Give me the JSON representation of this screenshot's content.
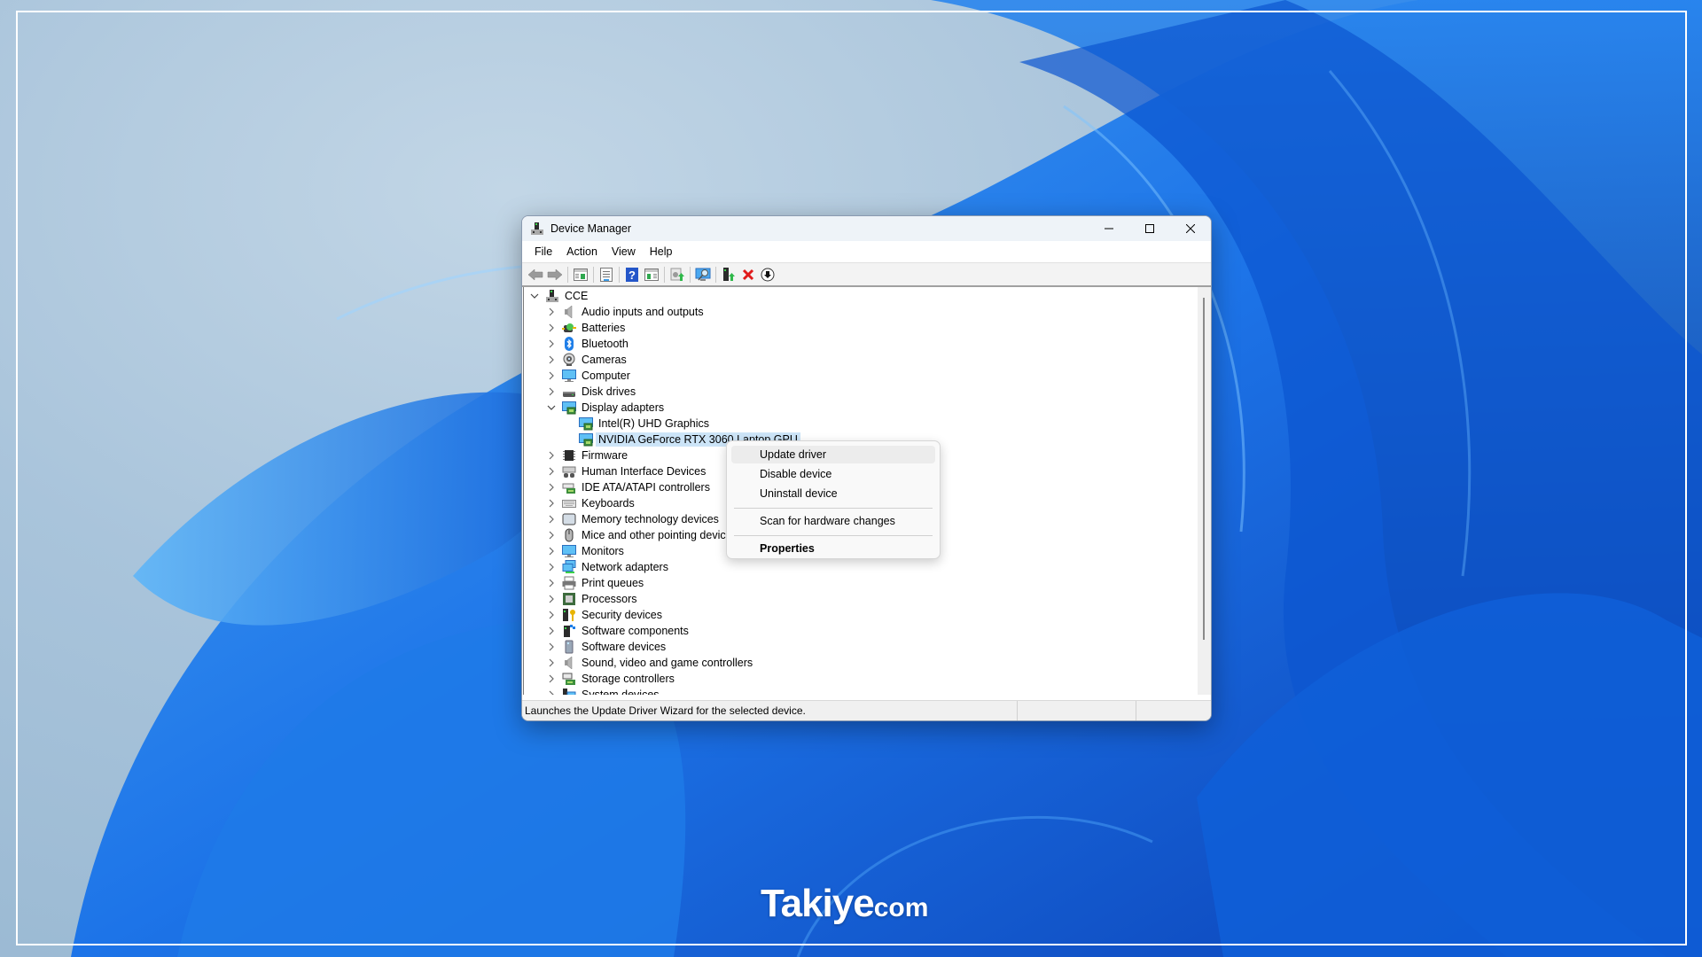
{
  "window": {
    "title": "Device Manager",
    "controls": [
      "minimize",
      "maximize",
      "close"
    ]
  },
  "menubar": [
    "File",
    "Action",
    "View",
    "Help"
  ],
  "toolbar": [
    {
      "icon": "back-arrow-icon",
      "label": "Back"
    },
    {
      "icon": "forward-arrow-icon",
      "label": "Forward"
    },
    {
      "icon": "show-hide-console-tree-icon",
      "label": "Show/Hide Console Tree"
    },
    {
      "icon": "properties-icon",
      "label": "Properties"
    },
    {
      "icon": "help-icon",
      "label": "Help"
    },
    {
      "icon": "show-hide-action-pane-icon",
      "label": "Show/Hide Action Pane"
    },
    {
      "icon": "update-driver-icon",
      "label": "Update driver"
    },
    {
      "icon": "scan-hardware-icon",
      "label": "Scan for hardware changes"
    },
    {
      "icon": "add-legacy-hardware-icon",
      "label": "Add drivers"
    },
    {
      "icon": "uninstall-device-icon",
      "label": "Uninstall device"
    },
    {
      "icon": "disable-device-icon",
      "label": "Disable device"
    }
  ],
  "tree": {
    "root": {
      "label": "CCE",
      "expanded": true,
      "icon": "computer-tower-icon"
    },
    "items": [
      {
        "label": "Audio inputs and outputs",
        "icon": "speaker-icon",
        "expanded": false
      },
      {
        "label": "Batteries",
        "icon": "battery-icon",
        "expanded": false
      },
      {
        "label": "Bluetooth",
        "icon": "bluetooth-icon",
        "expanded": false
      },
      {
        "label": "Cameras",
        "icon": "camera-icon",
        "expanded": false
      },
      {
        "label": "Computer",
        "icon": "monitor-icon",
        "expanded": false
      },
      {
        "label": "Disk drives",
        "icon": "disk-drive-icon",
        "expanded": false
      },
      {
        "label": "Display adapters",
        "icon": "display-adapter-icon",
        "expanded": true,
        "children": [
          {
            "label": "Intel(R) UHD Graphics",
            "icon": "display-adapter-icon",
            "selected": false
          },
          {
            "label": "NVIDIA GeForce RTX 3060 Laptop GPU",
            "icon": "display-adapter-icon",
            "selected": true
          }
        ]
      },
      {
        "label": "Firmware",
        "icon": "chip-icon",
        "expanded": false
      },
      {
        "label": "Human Interface Devices",
        "icon": "hid-icon",
        "expanded": false
      },
      {
        "label": "IDE ATA/ATAPI controllers",
        "icon": "ide-controller-icon",
        "expanded": false
      },
      {
        "label": "Keyboards",
        "icon": "keyboard-icon",
        "expanded": false
      },
      {
        "label": "Memory technology devices",
        "icon": "memory-card-icon",
        "expanded": false
      },
      {
        "label": "Mice and other pointing devices",
        "icon": "mouse-icon",
        "expanded": false
      },
      {
        "label": "Monitors",
        "icon": "monitor-icon",
        "expanded": false
      },
      {
        "label": "Network adapters",
        "icon": "network-icon",
        "expanded": false
      },
      {
        "label": "Print queues",
        "icon": "printer-icon",
        "expanded": false
      },
      {
        "label": "Processors",
        "icon": "processor-icon",
        "expanded": false
      },
      {
        "label": "Security devices",
        "icon": "security-key-icon",
        "expanded": false
      },
      {
        "label": "Software components",
        "icon": "software-component-icon",
        "expanded": false
      },
      {
        "label": "Software devices",
        "icon": "software-device-icon",
        "expanded": false
      },
      {
        "label": "Sound, video and game controllers",
        "icon": "speaker-icon",
        "expanded": false
      },
      {
        "label": "Storage controllers",
        "icon": "storage-controller-icon",
        "expanded": false
      },
      {
        "label": "System devices",
        "icon": "system-devices-icon",
        "expanded": false
      }
    ]
  },
  "context_menu": {
    "items": [
      {
        "label": "Update driver",
        "hover": true,
        "bold": false
      },
      {
        "label": "Disable device",
        "hover": false,
        "bold": false
      },
      {
        "label": "Uninstall device",
        "hover": false,
        "bold": false
      },
      {
        "separator": true
      },
      {
        "label": "Scan for hardware changes",
        "hover": false,
        "bold": false
      },
      {
        "separator": true
      },
      {
        "label": "Properties",
        "hover": false,
        "bold": true
      }
    ]
  },
  "statusbar": {
    "text": "Launches the Update Driver Wizard for the selected device."
  },
  "watermark": {
    "main": "Takiye",
    "suffix": "com"
  },
  "colors": {
    "selection": "#cce4f7",
    "titlebar": "#eef3f8",
    "wallpaper_blue": "#1a6fe6"
  }
}
